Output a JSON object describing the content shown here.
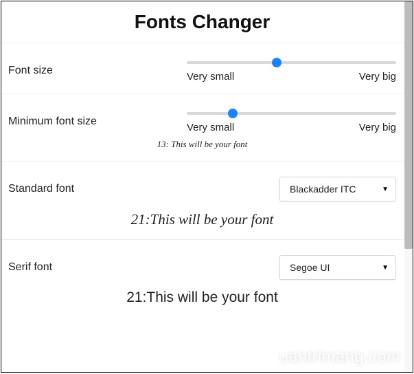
{
  "title": "Fonts Changer",
  "sections": {
    "fontSize": {
      "label": "Font size",
      "min": "Very small",
      "max": "Very big",
      "thumbPct": 43
    },
    "minFontSize": {
      "label": "Minimum font size",
      "min": "Very small",
      "max": "Very big",
      "thumbPct": 22,
      "preview": "13: This will be your font"
    },
    "standardFont": {
      "label": "Standard font",
      "selected": "Blackadder ITC",
      "preview": "21:This will be your font"
    },
    "serifFont": {
      "label": "Serif font",
      "selected": "Segoe UI",
      "preview": "21:This will be your font"
    }
  },
  "watermark": "uantrimang.com"
}
